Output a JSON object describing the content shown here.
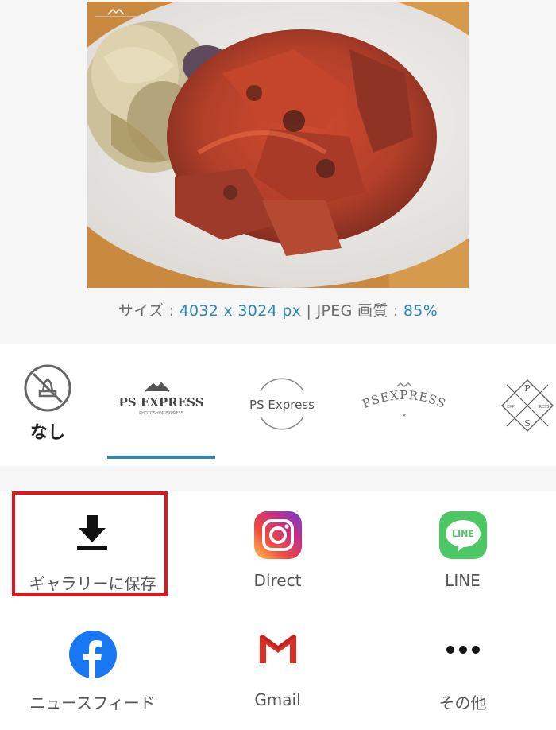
{
  "preview": {
    "photo_watermark": "PSEXPRESS",
    "size_label": "サイズ : ",
    "size_value": "4032 x 3024 px",
    "separator": " | ",
    "quality_label": "JPEG 画質 : ",
    "quality_value": "85%"
  },
  "watermarks": {
    "none_label": "なし",
    "items": [
      {
        "text": "PS EXPRESS",
        "sub": "PHOTOSHOP EXPRESS",
        "selected": true
      },
      {
        "text": "PS Express",
        "selected": false
      },
      {
        "text": "PSEXPRESS",
        "selected": false
      },
      {
        "letters": [
          "P",
          "S",
          "EXP",
          "RESS"
        ],
        "selected": false
      }
    ]
  },
  "share": {
    "items": [
      {
        "label": "ギャラリーに保存",
        "icon": "download-icon",
        "highlighted": true
      },
      {
        "label": "Direct",
        "icon": "instagram-icon"
      },
      {
        "label": "LINE",
        "icon": "line-icon",
        "icon_text": "LINE"
      },
      {
        "label": "ニュースフィード",
        "icon": "facebook-icon"
      },
      {
        "label": "Gmail",
        "icon": "gmail-icon"
      },
      {
        "label": "その他",
        "icon": "more-icon"
      }
    ]
  },
  "colors": {
    "accent": "#2f86b9",
    "highlight": "#e0161c",
    "line_green": "#4cc764",
    "facebook_blue": "#1877f2",
    "gmail_red": "#d93025"
  }
}
